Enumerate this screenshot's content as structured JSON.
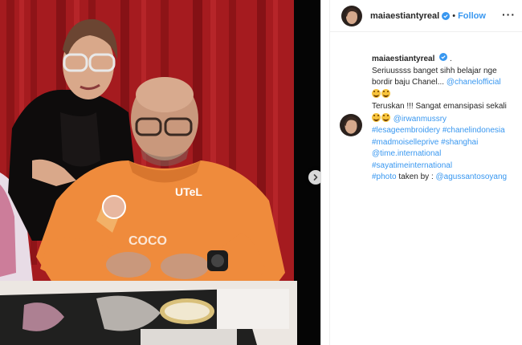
{
  "post": {
    "author": "maiaestiantyreal",
    "follow_label": "Follow",
    "dot": "•",
    "more_label": "···"
  },
  "caption": {
    "author": "maiaestiantyreal",
    "line1_suffix": " .",
    "line2": "Seriuussss banget sihh belajar nge",
    "line3_text": "bordir baju Chanel... ",
    "mention_chanel": "@chanelofficial",
    "line5": "Teruskan !!! Sangat emansipasi sekali",
    "mention_irwan": "@irwanmussry",
    "tags_line1": [
      "#lesageembroidery",
      "#chanelindonesia"
    ],
    "tags_line2": [
      "#madmoiselleprive",
      "#shanghai"
    ],
    "mention_time": "@time.international",
    "tag_sayatime": "#sayatimeinternational",
    "tag_photo": "#photo",
    "photo_credit_text": " taken by : ",
    "mention_agus": "@agussantosoyang"
  },
  "icons": {
    "verified": "verified-badge-icon",
    "next": "chevron-right-icon",
    "emoji": "grinning-face-icon"
  },
  "colors": {
    "link": "#3897f0",
    "verified": "#3897f0",
    "text": "#262626"
  }
}
